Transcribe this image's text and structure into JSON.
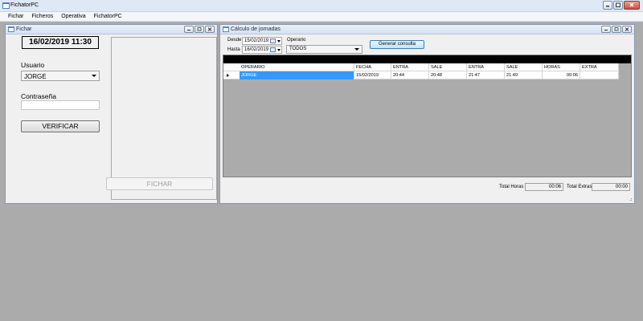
{
  "app": {
    "title": "FichatorPC"
  },
  "menu": [
    "Fichar",
    "Ficheros",
    "Operativa",
    "FichatorPC"
  ],
  "fichar": {
    "title": "Fichar",
    "datetime": "16/02/2019 11:30",
    "usuario_label": "Usuario",
    "usuario_value": "JORGE",
    "password_label": "Contraseña",
    "password_value": "",
    "verify_button": "VERIFICAR",
    "fichar_button": "FICHAR"
  },
  "calculo": {
    "title": "Cálculo de jornadas",
    "desde_label": "Desde",
    "desde_value": "15/02/2019",
    "hasta_label": "Hasta",
    "hasta_value": "16/02/2019",
    "operario_label": "Operario",
    "operario_value": "TODOS",
    "generate_button": "Generar consulta",
    "columns": [
      "OPERARIO",
      "FECHA",
      "ENTRA",
      "SALE",
      "ENTRA",
      "SALE",
      "HORAS",
      "EXTRA"
    ],
    "rows": [
      {
        "operario": "JORGE",
        "fecha": "15/02/2019",
        "entra1": "20:44",
        "sale1": "20:48",
        "entra2": "21:47",
        "sale2": "21:49",
        "horas": "00:06",
        "extra": ""
      }
    ],
    "total_horas_label": "Total Horas",
    "total_horas_value": "00:06",
    "total_extras_label": "Total Extras",
    "total_extras_value": "00:00"
  }
}
